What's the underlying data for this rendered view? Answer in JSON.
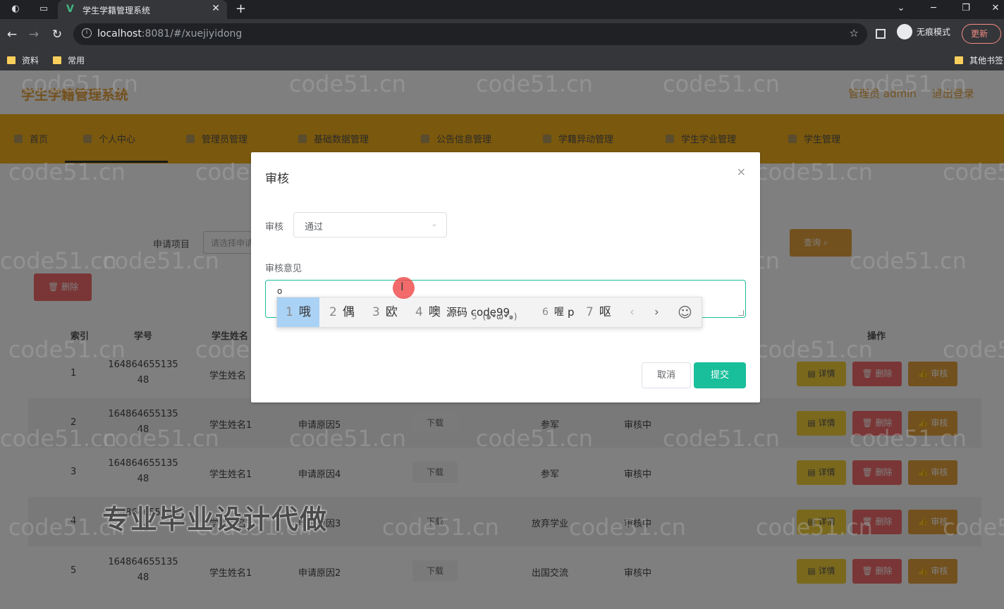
{
  "browser": {
    "tab_title": "学生学籍管理系统",
    "tab_close": "✕",
    "new_tab": "+",
    "url_host": "localhost",
    "url_rest": ":8081/#/xuejiyidong",
    "incognito_label": "无痕模式",
    "update_label": "更新",
    "bookmarks": [
      "资料",
      "常用"
    ],
    "other_bookmarks": "其他书签"
  },
  "app": {
    "title": "学生学籍管理系统",
    "user_label": "管理员 admin",
    "logout_label": "退出登录",
    "menu": [
      "首页",
      "个人中心",
      "管理员管理",
      "基础数据管理",
      "公告信息管理",
      "学籍异动管理",
      "学生学业管理",
      "学生管理"
    ],
    "search_label": "申请项目",
    "search_placeholder": "请选择申请",
    "query_button": "查询",
    "batch_delete_button": "删除",
    "table_headers": {
      "index": "索引",
      "student_no": "学号",
      "student_name": "学生姓名",
      "operation": "操作"
    },
    "rows": [
      {
        "index": "1",
        "student_no": "164864655135\n48",
        "name": "学生姓名",
        "reason": "",
        "download": "",
        "project": "",
        "status": ""
      },
      {
        "index": "2",
        "student_no": "164864655135\n48",
        "name": "学生姓名1",
        "reason": "申请原因5",
        "download": "下载",
        "project": "参军",
        "status": "审核中"
      },
      {
        "index": "3",
        "student_no": "164864655135\n48",
        "name": "学生姓名1",
        "reason": "申请原因4",
        "download": "下载",
        "project": "参军",
        "status": "审核中"
      },
      {
        "index": "4",
        "student_no": "164864655135\n48",
        "name": "学生姓名3",
        "reason": "申请原因3",
        "download": "下载",
        "project": "放弃学业",
        "status": "审核中"
      },
      {
        "index": "5",
        "student_no": "164864655135\n48",
        "name": "学生姓名1",
        "reason": "申请原因2",
        "download": "下载",
        "project": "出国交流",
        "status": "审核中"
      }
    ],
    "op_detail": "详情",
    "op_delete": "删除",
    "op_audit": "审核"
  },
  "modal": {
    "title": "审核",
    "close": "×",
    "audit_label": "审核",
    "audit_value": "通过",
    "opinion_label": "审核意见",
    "opinion_value": "o",
    "cancel": "取消",
    "submit": "提交"
  },
  "ime": {
    "candidates": [
      {
        "n": "1",
        "t": "哦"
      },
      {
        "n": "2",
        "t": "偶"
      },
      {
        "n": "3",
        "t": "欧"
      },
      {
        "n": "4",
        "t": "噢"
      },
      {
        "n": "5",
        "t": "(๑•̀ω•́๑)"
      },
      {
        "n": "6",
        "t": "喔"
      },
      {
        "n": "7",
        "t": "呕"
      }
    ],
    "prev": "‹",
    "next": "›",
    "emoji": "☺"
  },
  "overlays": {
    "watermark": "code51.cn",
    "ime_overlap_text": "源码 code99",
    "ime_overlap_extra": "p",
    "promo": "专业毕业设计代做"
  }
}
